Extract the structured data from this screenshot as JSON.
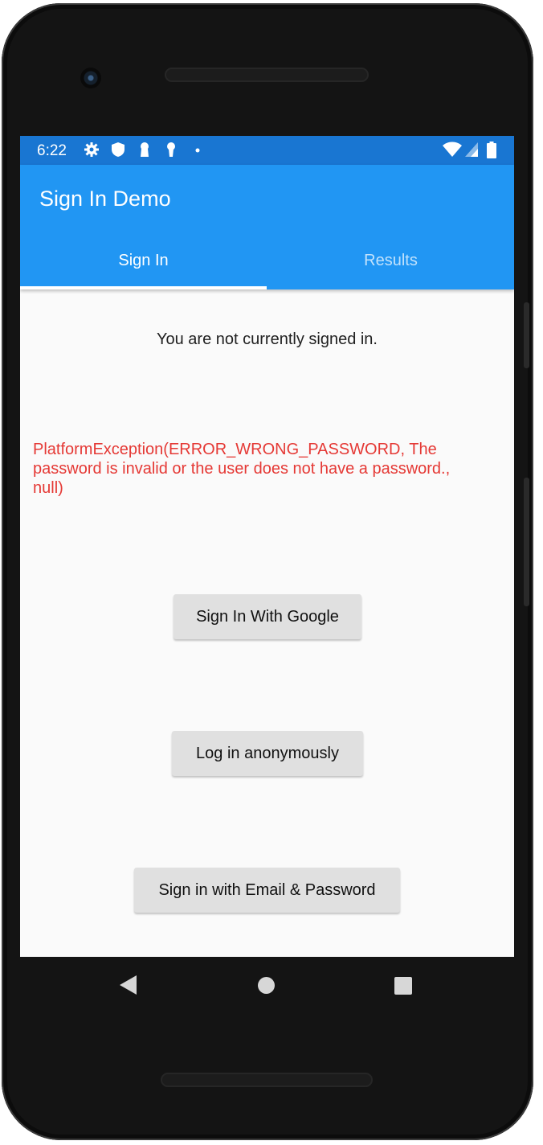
{
  "status_bar": {
    "time": "6:22",
    "icons": [
      "gear-icon",
      "shield-icon",
      "keyhole-icon",
      "keyhole-icon",
      "dot-icon",
      "wifi-icon",
      "signal-icon",
      "battery-icon"
    ]
  },
  "app_bar": {
    "title": "Sign In Demo",
    "color": "#2196f3",
    "status_color": "#1976d2"
  },
  "tabs": [
    {
      "label": "Sign In",
      "active": true
    },
    {
      "label": "Results",
      "active": false
    }
  ],
  "main": {
    "status_text": "You are not currently signed in.",
    "error_text": "PlatformException(ERROR_WRONG_PASSWORD, The password is invalid or the user does not have a password., null)",
    "error_color": "#e53935",
    "buttons": {
      "google": "Sign In With Google",
      "anonymous": "Log in anonymously",
      "email": "Sign in with Email & Password"
    }
  },
  "nav_bar": {
    "icons": [
      "back-icon",
      "home-icon",
      "recents-icon"
    ]
  }
}
